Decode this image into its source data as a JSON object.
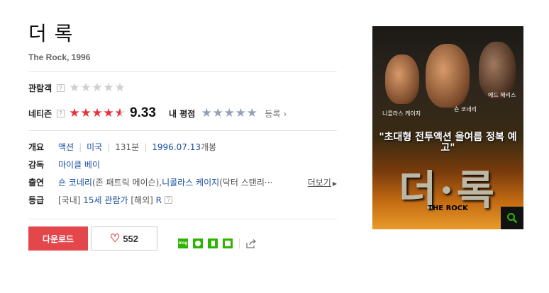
{
  "movie": {
    "title": "더 록",
    "subtitle": "The Rock, 1996"
  },
  "ratings": {
    "audience_label": "관람객",
    "audience_stars": 0,
    "netizen_label": "네티즌",
    "netizen_score": "9.33",
    "netizen_stars": 4.7,
    "my_rating_label": "내 평점",
    "my_stars": 0,
    "register_label": "등록",
    "help_glyph": "?"
  },
  "details": {
    "overview_label": "개요",
    "genre": "액션",
    "country": "미국",
    "runtime": "131분",
    "release": "1996.07.13",
    "release_suffix": "개봉",
    "director_label": "감독",
    "director": "마이클 베이",
    "cast_label": "출연",
    "cast_1": "숀 코네리",
    "cast_1_role": "(존 패트릭 메이슨), ",
    "cast_2": "니콜라스 케이지",
    "cast_2_role": "(닥터 스탠리···",
    "more_label": "더보기",
    "rating_label": "등급",
    "rating_domestic_prefix": "[국내]",
    "rating_domestic": "15세 관람가",
    "rating_foreign_prefix": "[해외]",
    "rating_foreign": "R"
  },
  "actions": {
    "download_label": "다운로드",
    "like_count": "552"
  },
  "poster": {
    "tagline": "\"초대형 전투액션 올여름 정복 예고\"",
    "title": "더·록",
    "subtitle": "THE ROCK",
    "cast_left": "니콜라스 케이지",
    "cast_center": "숀 코네리",
    "cast_right": "에드 해리스"
  },
  "colors": {
    "accent_red": "#e3474c",
    "link_blue": "#1a4fa0",
    "star_red": "#e8303a",
    "star_blue": "#93a0b6"
  }
}
